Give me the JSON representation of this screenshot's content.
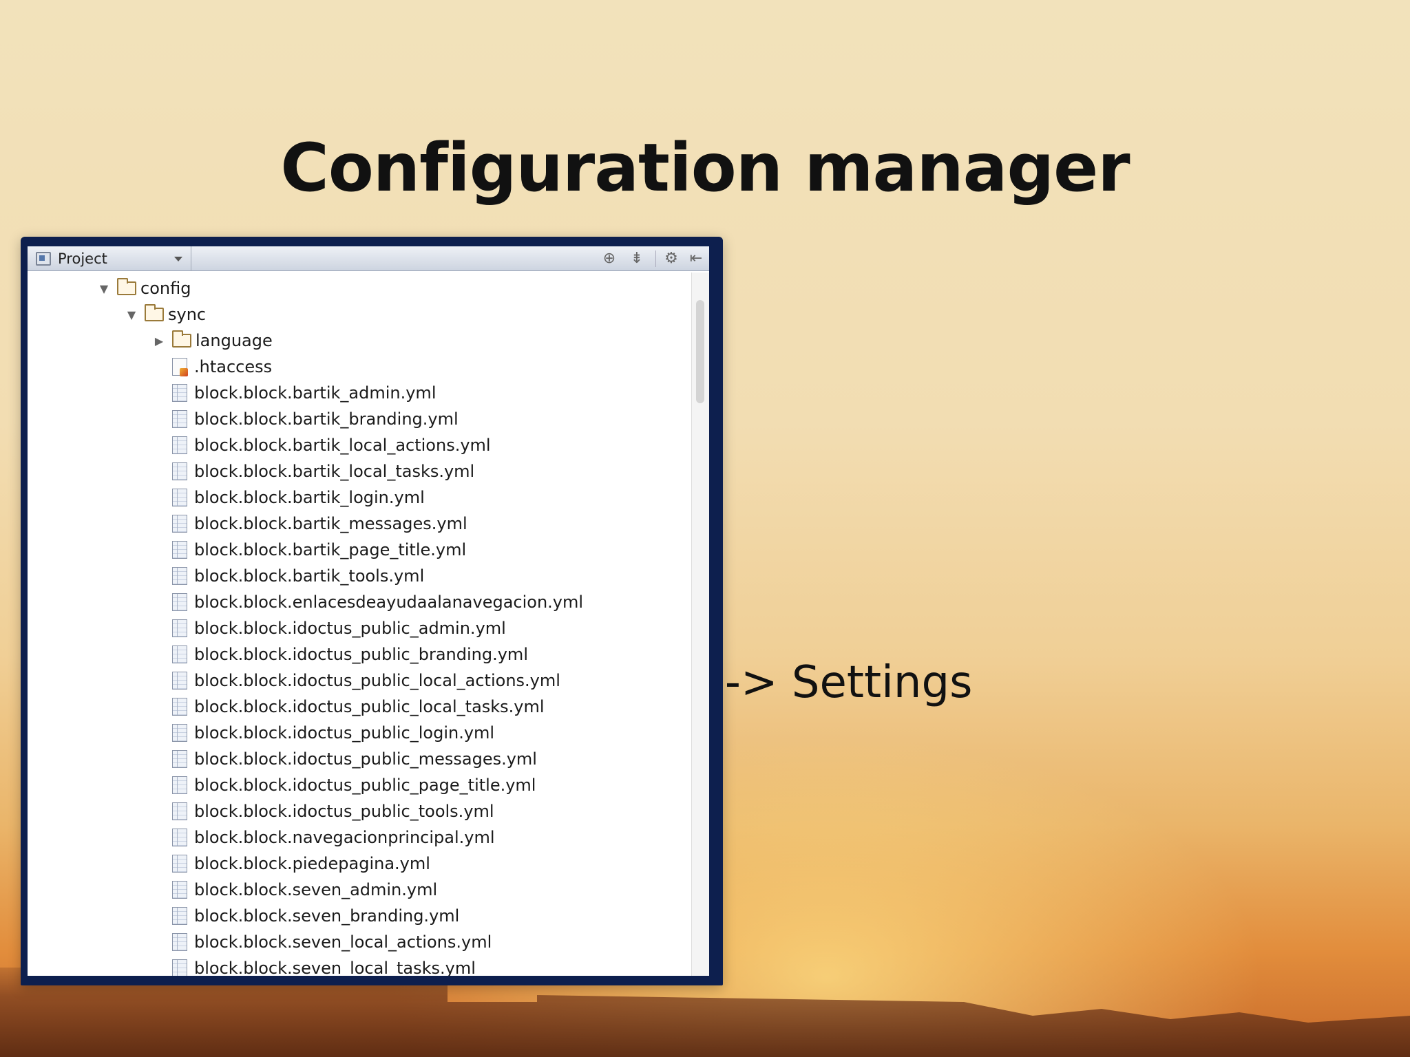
{
  "slide": {
    "title": "Configuration manager",
    "bullet_visible_text": "os -> Settings"
  },
  "project_panel": {
    "combo_label": "Project",
    "toolbar_icons": [
      "target-icon",
      "collapse-all-icon",
      "gear-icon",
      "hide-panel-icon"
    ],
    "tree": [
      {
        "label": "config",
        "type": "folder",
        "expanded": true,
        "depth": 0
      },
      {
        "label": "sync",
        "type": "folder",
        "expanded": true,
        "depth": 1
      },
      {
        "label": "language",
        "type": "folder",
        "expanded": false,
        "depth": 2
      },
      {
        "label": ".htaccess",
        "type": "htaccess",
        "depth": 2
      },
      {
        "label": "block.block.bartik_admin.yml",
        "type": "file",
        "depth": 2
      },
      {
        "label": "block.block.bartik_branding.yml",
        "type": "file",
        "depth": 2
      },
      {
        "label": "block.block.bartik_local_actions.yml",
        "type": "file",
        "depth": 2
      },
      {
        "label": "block.block.bartik_local_tasks.yml",
        "type": "file",
        "depth": 2
      },
      {
        "label": "block.block.bartik_login.yml",
        "type": "file",
        "depth": 2
      },
      {
        "label": "block.block.bartik_messages.yml",
        "type": "file",
        "depth": 2
      },
      {
        "label": "block.block.bartik_page_title.yml",
        "type": "file",
        "depth": 2
      },
      {
        "label": "block.block.bartik_tools.yml",
        "type": "file",
        "depth": 2
      },
      {
        "label": "block.block.enlacesdeayudaalanavegacion.yml",
        "type": "file",
        "depth": 2
      },
      {
        "label": "block.block.idoctus_public_admin.yml",
        "type": "file",
        "depth": 2
      },
      {
        "label": "block.block.idoctus_public_branding.yml",
        "type": "file",
        "depth": 2
      },
      {
        "label": "block.block.idoctus_public_local_actions.yml",
        "type": "file",
        "depth": 2
      },
      {
        "label": "block.block.idoctus_public_local_tasks.yml",
        "type": "file",
        "depth": 2
      },
      {
        "label": "block.block.idoctus_public_login.yml",
        "type": "file",
        "depth": 2
      },
      {
        "label": "block.block.idoctus_public_messages.yml",
        "type": "file",
        "depth": 2
      },
      {
        "label": "block.block.idoctus_public_page_title.yml",
        "type": "file",
        "depth": 2
      },
      {
        "label": "block.block.idoctus_public_tools.yml",
        "type": "file",
        "depth": 2
      },
      {
        "label": "block.block.navegacionprincipal.yml",
        "type": "file",
        "depth": 2
      },
      {
        "label": "block.block.piedepagina.yml",
        "type": "file",
        "depth": 2
      },
      {
        "label": "block.block.seven_admin.yml",
        "type": "file",
        "depth": 2
      },
      {
        "label": "block.block.seven_branding.yml",
        "type": "file",
        "depth": 2
      },
      {
        "label": "block.block.seven_local_actions.yml",
        "type": "file",
        "depth": 2
      },
      {
        "label": "block.block.seven_local_tasks.yml",
        "type": "file",
        "depth": 2
      }
    ]
  },
  "colors": {
    "frame": "#0d1f4e",
    "title_text": "#111111"
  }
}
